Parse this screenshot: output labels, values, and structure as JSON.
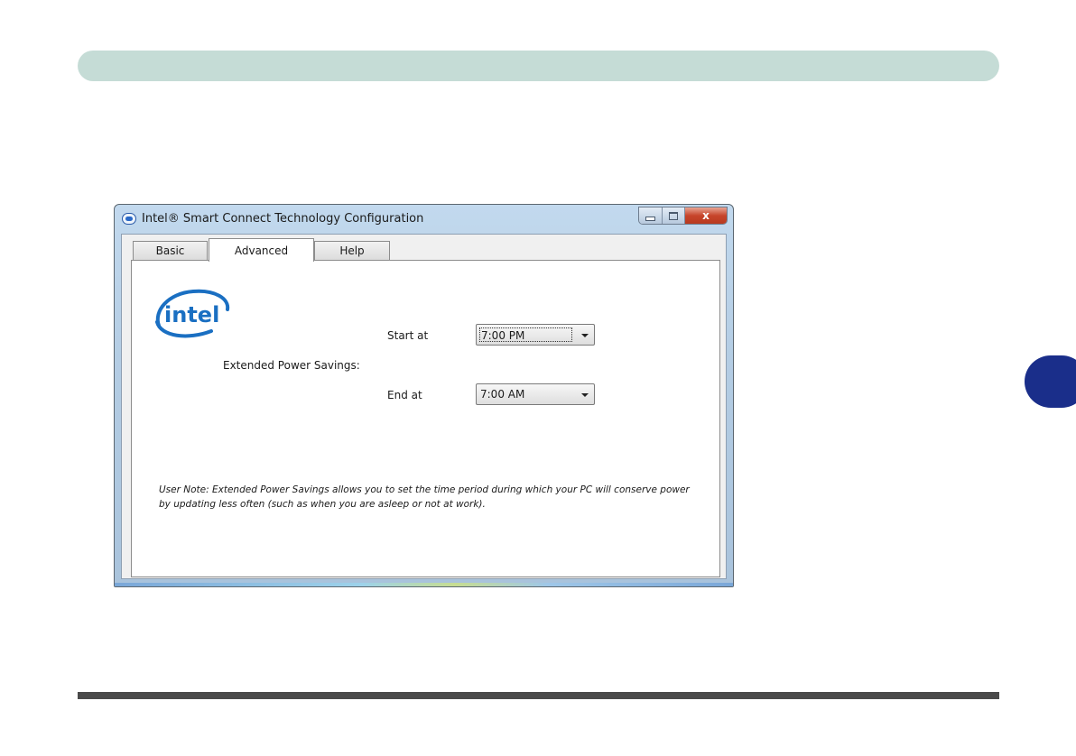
{
  "window": {
    "title": "Intel® Smart Connect Technology Configuration",
    "close_glyph": "x"
  },
  "tabs": [
    {
      "label": "Basic",
      "selected": false
    },
    {
      "label": "Advanced",
      "selected": true
    },
    {
      "label": "Help",
      "selected": false
    }
  ],
  "logo_text": "intel",
  "settings": {
    "section_label": "Extended Power Savings:",
    "start_label": "Start at",
    "start_value": "7:00 PM",
    "end_label": "End at",
    "end_value": "7:00 AM"
  },
  "note": "User Note: Extended Power Savings allows you to set the time period during which your PC will conserve power by updating less often (such as when you are asleep or not at work).",
  "icons": {
    "app": "intel-app-icon",
    "minimize": "minimize-icon",
    "maximize": "maximize-icon",
    "close": "close-icon",
    "dropdown": "chevron-down-icon"
  },
  "colors": {
    "header_bar": "#c5dcd6",
    "side_tab": "#1a2e8a",
    "intel_blue": "#1a6fc2"
  }
}
